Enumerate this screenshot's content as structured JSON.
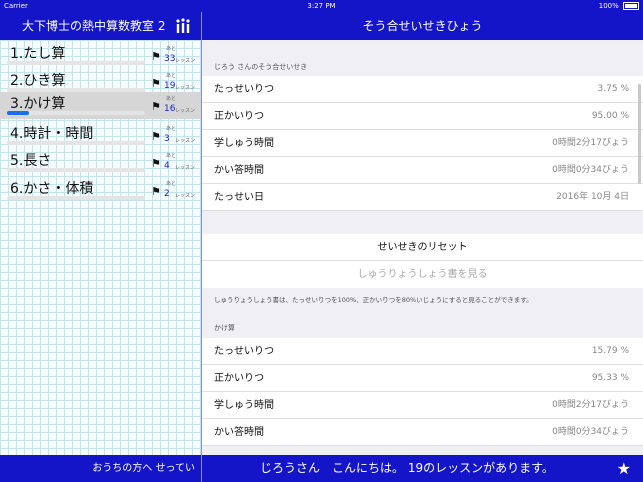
{
  "status_bar": {
    "carrier": "Carrier",
    "wifi_icon": "wifi-icon",
    "time": "3:27 PM",
    "battery_label": "100%"
  },
  "sidebar": {
    "title": "大下博士の熱中算数教室 2",
    "stats_icon": "bar-chart-icon",
    "lessons": [
      {
        "name": "1.たし算",
        "ato": "あと",
        "count": "33",
        "unit": "レッスン",
        "progress": 0.0
      },
      {
        "name": "2.ひき算",
        "ato": "あと",
        "count": "19",
        "unit": "レッスン",
        "progress": 0.0
      },
      {
        "name": "3.かけ算",
        "ato": "あと",
        "count": "16",
        "unit": "レッスン",
        "progress": 0.16
      },
      {
        "name": "4.時計・時間",
        "ato": "あと",
        "count": "3",
        "unit": "レッスン",
        "progress": 0.0
      },
      {
        "name": "5.長さ",
        "ato": "あと",
        "count": "4",
        "unit": "レッスン",
        "progress": 0.0
      },
      {
        "name": "6.かさ・体積",
        "ato": "あと",
        "count": "2",
        "unit": "レッスン",
        "progress": 0.0
      }
    ],
    "footer": "おうちの方へ  せってい"
  },
  "main": {
    "title": "そう合せいせきひょう",
    "overall_header": "じろう さんのそう合せいせき",
    "overall_rows": [
      {
        "label": "たっせいりつ",
        "value": "3.75 %"
      },
      {
        "label": "正かいりつ",
        "value": "95.00 %"
      },
      {
        "label": "学しゅう時間",
        "value": "0時間2分17びょう"
      },
      {
        "label": "かい答時間",
        "value": "0時間0分34びょう"
      },
      {
        "label": "たっせい日",
        "value": "2016年 10月 4日"
      }
    ],
    "reset_label": "せいせきのリセット",
    "certificate_label": "しゅうりょうしょう書を見る",
    "note": "しゅうりょうしょう書は、たっせいりつを100%、正かいりつを80%いじょうにすると見ることができます。",
    "multiplication_header": "かけ算",
    "multiplication_rows": [
      {
        "label": "たっせいりつ",
        "value": "15.79 %"
      },
      {
        "label": "正かいりつ",
        "value": "95.33 %"
      },
      {
        "label": "学しゅう時間",
        "value": "0時間2分17びょう"
      },
      {
        "label": "かい答時間",
        "value": "0時間0分34びょう"
      }
    ]
  },
  "footer": {
    "message": "じろうさん　こんにちは。 19のレッスンがあります。",
    "star_icon": "star-icon"
  }
}
